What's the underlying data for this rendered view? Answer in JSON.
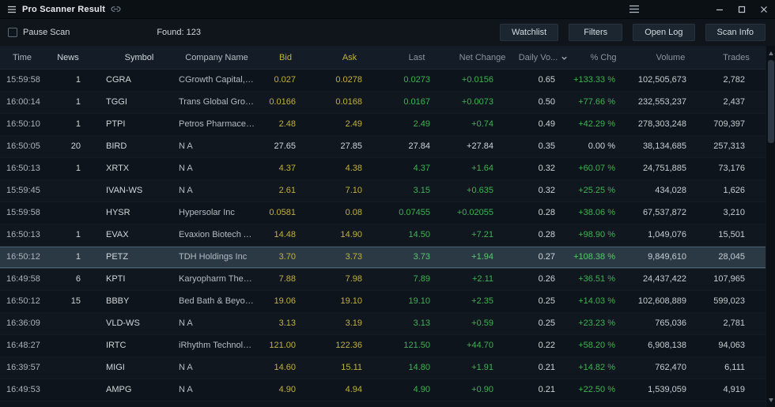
{
  "window": {
    "title": "Pro Scanner Result"
  },
  "toolbar": {
    "pause_scan_label": "Pause Scan",
    "pause_scan_checked": false,
    "found_text": "Found: 123",
    "buttons": [
      {
        "label": "Watchlist"
      },
      {
        "label": "Filters"
      },
      {
        "label": "Open Log"
      },
      {
        "label": "Scan Info"
      }
    ]
  },
  "table": {
    "columns": [
      "Time",
      "News",
      "Symbol",
      "Company Name",
      "Bid",
      "Ask",
      "Last",
      "Net Change",
      "Daily Vo...",
      "% Chg",
      "Volume",
      "Trades"
    ],
    "sorted_column": "Daily Vo...",
    "sort_direction": "desc",
    "rows": [
      {
        "time": "15:59:58",
        "news": "1",
        "symbol": "CGRA",
        "company": "CGrowth Capital, I...",
        "bid": "0.027",
        "ask": "0.0278",
        "last": "0.0273",
        "net_change": "+0.0156",
        "daily_vol": "0.65",
        "pct_chg": "+133.33 %",
        "volume": "102,505,673",
        "trades": "2,782"
      },
      {
        "time": "16:00:14",
        "news": "1",
        "symbol": "TGGI",
        "company": "Trans Global Grou...",
        "bid": "0.0166",
        "ask": "0.0168",
        "last": "0.0167",
        "net_change": "+0.0073",
        "daily_vol": "0.50",
        "pct_chg": "+77.66 %",
        "volume": "232,553,237",
        "trades": "2,437"
      },
      {
        "time": "16:50:10",
        "news": "1",
        "symbol": "PTPI",
        "company": "Petros Pharmaceu...",
        "bid": "2.48",
        "ask": "2.49",
        "last": "2.49",
        "net_change": "+0.74",
        "daily_vol": "0.49",
        "pct_chg": "+42.29 %",
        "volume": "278,303,248",
        "trades": "709,397"
      },
      {
        "time": "16:50:05",
        "news": "20",
        "symbol": "BIRD",
        "company": "N A",
        "bid": "27.65",
        "ask": "27.85",
        "last": "27.84",
        "net_change": "+27.84",
        "daily_vol": "0.35",
        "pct_chg": "0.00 %",
        "volume": "38,134,685",
        "trades": "257,313",
        "neutral": true
      },
      {
        "time": "16:50:13",
        "news": "1",
        "symbol": "XRTX",
        "company": "N A",
        "bid": "4.37",
        "ask": "4.38",
        "last": "4.37",
        "net_change": "+1.64",
        "daily_vol": "0.32",
        "pct_chg": "+60.07 %",
        "volume": "24,751,885",
        "trades": "73,176"
      },
      {
        "time": "15:59:45",
        "news": "",
        "symbol": "IVAN-WS",
        "company": "N A",
        "bid": "2.61",
        "ask": "7.10",
        "last": "3.15",
        "net_change": "+0.635",
        "daily_vol": "0.32",
        "pct_chg": "+25.25 %",
        "volume": "434,028",
        "trades": "1,626"
      },
      {
        "time": "15:59:58",
        "news": "",
        "symbol": "HYSR",
        "company": "Hypersolar Inc",
        "bid": "0.0581",
        "ask": "0.08",
        "last": "0.07455",
        "net_change": "+0.02055",
        "daily_vol": "0.28",
        "pct_chg": "+38.06 %",
        "volume": "67,537,872",
        "trades": "3,210"
      },
      {
        "time": "16:50:13",
        "news": "1",
        "symbol": "EVAX",
        "company": "Evaxion Biotech A/S",
        "bid": "14.48",
        "ask": "14.90",
        "last": "14.50",
        "net_change": "+7.21",
        "daily_vol": "0.28",
        "pct_chg": "+98.90 %",
        "volume": "1,049,076",
        "trades": "15,501"
      },
      {
        "time": "16:50:12",
        "news": "1",
        "symbol": "PETZ",
        "company": "TDH Holdings Inc",
        "bid": "3.70",
        "ask": "3.73",
        "last": "3.73",
        "net_change": "+1.94",
        "daily_vol": "0.27",
        "pct_chg": "+108.38 %",
        "volume": "9,849,610",
        "trades": "28,045",
        "selected": true
      },
      {
        "time": "16:49:58",
        "news": "6",
        "symbol": "KPTI",
        "company": "Karyopharm Thera...",
        "bid": "7.88",
        "ask": "7.98",
        "last": "7.89",
        "net_change": "+2.11",
        "daily_vol": "0.26",
        "pct_chg": "+36.51 %",
        "volume": "24,437,422",
        "trades": "107,965"
      },
      {
        "time": "16:50:12",
        "news": "15",
        "symbol": "BBBY",
        "company": "Bed Bath & Beyon...",
        "bid": "19.06",
        "ask": "19.10",
        "last": "19.10",
        "net_change": "+2.35",
        "daily_vol": "0.25",
        "pct_chg": "+14.03 %",
        "volume": "102,608,889",
        "trades": "599,023"
      },
      {
        "time": "16:36:09",
        "news": "",
        "symbol": "VLD-WS",
        "company": "N A",
        "bid": "3.13",
        "ask": "3.19",
        "last": "3.13",
        "net_change": "+0.59",
        "daily_vol": "0.25",
        "pct_chg": "+23.23 %",
        "volume": "765,036",
        "trades": "2,781"
      },
      {
        "time": "16:48:27",
        "news": "",
        "symbol": "IRTC",
        "company": "iRhythm Technolo...",
        "bid": "121.00",
        "ask": "122.36",
        "last": "121.50",
        "net_change": "+44.70",
        "daily_vol": "0.22",
        "pct_chg": "+58.20 %",
        "volume": "6,908,138",
        "trades": "94,063"
      },
      {
        "time": "16:39:57",
        "news": "",
        "symbol": "MIGI",
        "company": "N A",
        "bid": "14.60",
        "ask": "15.11",
        "last": "14.80",
        "net_change": "+1.91",
        "daily_vol": "0.21",
        "pct_chg": "+14.82 %",
        "volume": "762,470",
        "trades": "6,111"
      },
      {
        "time": "16:49:53",
        "news": "",
        "symbol": "AMPG",
        "company": "N A",
        "bid": "4.90",
        "ask": "4.94",
        "last": "4.90",
        "net_change": "+0.90",
        "daily_vol": "0.21",
        "pct_chg": "+22.50 %",
        "volume": "1,539,059",
        "trades": "4,919"
      }
    ]
  },
  "colors": {
    "green": "#3fb253",
    "green_bright": "#55c96d",
    "yellow": "#c2b13c",
    "selected_row_bg": "#2b3945",
    "header_bg": "#141d27",
    "row_odd_bg": "#0d141b",
    "row_even_bg": "#10171f",
    "titlebar_bg": "#0b1015",
    "toolbar_bg": "#0f151b",
    "button_bg": "#1c2630",
    "window_bg": "#0d141b"
  }
}
